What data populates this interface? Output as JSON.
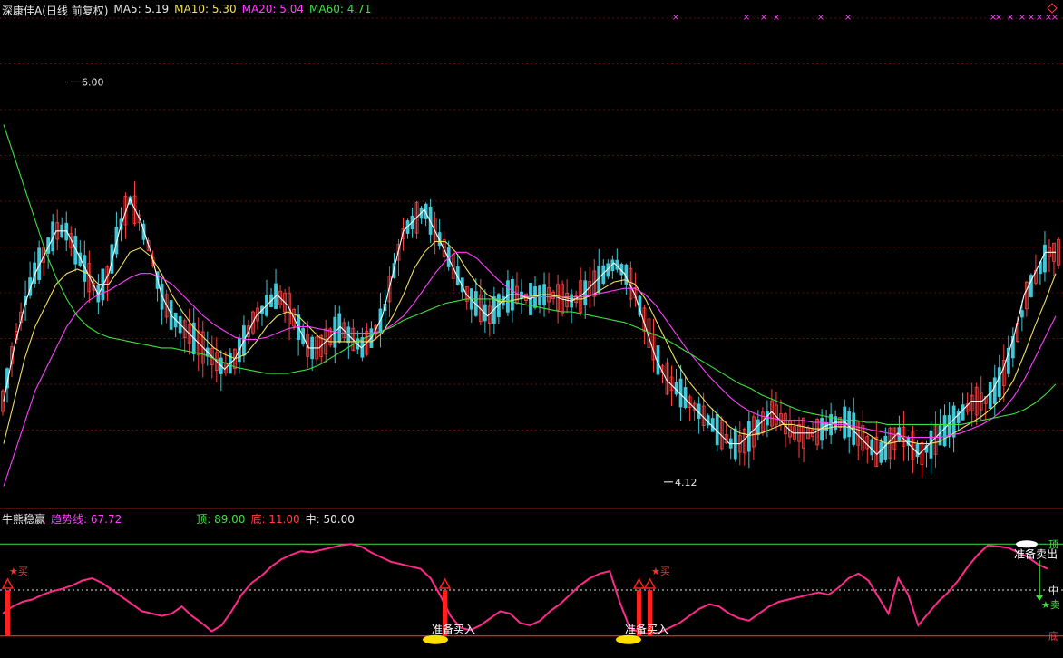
{
  "price_header": {
    "title": "深康佳A(日线 前复权)",
    "ma5": "MA5: 5.19",
    "ma10": "MA10: 5.30",
    "ma20": "MA20: 5.04",
    "ma60": "MA60: 4.71"
  },
  "indicator_header": {
    "title": "牛熊稳赢",
    "trend": "趋势线: 67.72",
    "top": "顶: 89.00",
    "bottom": "底: 11.00",
    "mid": "中: 50.00"
  },
  "colors": {
    "up": "#ff4040",
    "down": "#40c8d8",
    "ma5": "#ffffff",
    "ma10": "#f0e060",
    "ma20": "#ff40ff",
    "ma60": "#40e040",
    "trend": "#ff2a8a"
  },
  "chart_data": [
    {
      "type": "candlestick",
      "ylim": [
        4.0,
        6.3
      ],
      "grid": true,
      "annotations": [
        {
          "label": "6.00",
          "x": 78,
          "value": 6.0
        },
        {
          "label": "4.12",
          "x": 732,
          "value": 4.12
        }
      ],
      "series": [
        {
          "name": "MA5",
          "values": [
            4.5,
            4.75,
            4.95,
            5.1,
            5.2,
            5.3,
            5.3,
            5.2,
            5.1,
            5.0,
            5.1,
            5.3,
            5.45,
            5.35,
            5.2,
            5.0,
            4.9,
            4.85,
            4.8,
            4.75,
            4.7,
            4.65,
            4.7,
            4.8,
            4.9,
            4.95,
            5.0,
            4.95,
            4.85,
            4.75,
            4.75,
            4.8,
            4.85,
            4.8,
            4.75,
            4.8,
            4.9,
            5.1,
            5.3,
            5.35,
            5.4,
            5.3,
            5.2,
            5.1,
            5.0,
            4.95,
            4.9,
            4.95,
            5.0,
            5.0,
            4.98,
            5.0,
            5.0,
            4.98,
            4.97,
            5.0,
            5.05,
            5.1,
            5.15,
            5.1,
            5.0,
            4.85,
            4.7,
            4.6,
            4.55,
            4.5,
            4.45,
            4.4,
            4.35,
            4.3,
            4.3,
            4.35,
            4.4,
            4.45,
            4.4,
            4.35,
            4.35,
            4.35,
            4.38,
            4.4,
            4.4,
            4.35,
            4.3,
            4.25,
            4.3,
            4.35,
            4.3,
            4.25,
            4.3,
            4.35,
            4.4,
            4.45,
            4.5,
            4.5,
            4.55,
            4.65,
            4.8,
            5.0,
            5.1,
            5.2,
            5.2
          ]
        },
        {
          "name": "MA10",
          "values": [
            4.3,
            4.5,
            4.7,
            4.85,
            4.95,
            5.05,
            5.1,
            5.12,
            5.1,
            5.05,
            5.05,
            5.12,
            5.2,
            5.22,
            5.18,
            5.1,
            5.0,
            4.92,
            4.85,
            4.8,
            4.75,
            4.72,
            4.7,
            4.72,
            4.78,
            4.85,
            4.9,
            4.92,
            4.9,
            4.85,
            4.8,
            4.78,
            4.78,
            4.78,
            4.78,
            4.78,
            4.82,
            4.9,
            5.0,
            5.12,
            5.2,
            5.25,
            5.25,
            5.2,
            5.12,
            5.05,
            5.0,
            4.97,
            4.97,
            4.98,
            4.99,
            5.0,
            5.0,
            4.99,
            4.98,
            4.98,
            5.0,
            5.03,
            5.06,
            5.07,
            5.05,
            4.98,
            4.88,
            4.78,
            4.68,
            4.6,
            4.54,
            4.48,
            4.43,
            4.38,
            4.35,
            4.34,
            4.35,
            4.37,
            4.39,
            4.39,
            4.38,
            4.37,
            4.37,
            4.38,
            4.38,
            4.37,
            4.35,
            4.32,
            4.3,
            4.31,
            4.31,
            4.3,
            4.3,
            4.31,
            4.34,
            4.37,
            4.4,
            4.43,
            4.47,
            4.52,
            4.6,
            4.72,
            4.85,
            4.97,
            5.1
          ]
        },
        {
          "name": "MA20",
          "values": [
            4.1,
            4.25,
            4.4,
            4.55,
            4.65,
            4.75,
            4.85,
            4.92,
            4.97,
            5.0,
            5.02,
            5.05,
            5.08,
            5.1,
            5.1,
            5.08,
            5.05,
            5.0,
            4.95,
            4.9,
            4.86,
            4.83,
            4.8,
            4.79,
            4.79,
            4.8,
            4.82,
            4.84,
            4.85,
            4.85,
            4.84,
            4.83,
            4.82,
            4.82,
            4.82,
            4.82,
            4.83,
            4.86,
            4.9,
            4.96,
            5.03,
            5.1,
            5.16,
            5.2,
            5.2,
            5.17,
            5.12,
            5.07,
            5.03,
            5.0,
            4.99,
            4.99,
            4.99,
            4.99,
            4.99,
            4.99,
            5.0,
            5.01,
            5.02,
            5.03,
            5.03,
            5.0,
            4.95,
            4.88,
            4.81,
            4.74,
            4.68,
            4.62,
            4.57,
            4.52,
            4.48,
            4.45,
            4.43,
            4.42,
            4.41,
            4.41,
            4.41,
            4.4,
            4.4,
            4.39,
            4.39,
            4.38,
            4.37,
            4.36,
            4.35,
            4.34,
            4.33,
            4.33,
            4.33,
            4.33,
            4.34,
            4.35,
            4.37,
            4.39,
            4.42,
            4.46,
            4.52,
            4.6,
            4.7,
            4.8,
            4.9
          ]
        },
        {
          "name": "MA60",
          "values": [
            5.8,
            5.65,
            5.5,
            5.35,
            5.2,
            5.08,
            4.98,
            4.9,
            4.85,
            4.82,
            4.8,
            4.79,
            4.78,
            4.77,
            4.76,
            4.75,
            4.75,
            4.74,
            4.73,
            4.72,
            4.7,
            4.68,
            4.66,
            4.65,
            4.64,
            4.63,
            4.63,
            4.63,
            4.64,
            4.65,
            4.67,
            4.7,
            4.73,
            4.76,
            4.79,
            4.81,
            4.83,
            4.85,
            4.88,
            4.9,
            4.92,
            4.94,
            4.96,
            4.97,
            4.98,
            4.98,
            4.98,
            4.98,
            4.97,
            4.96,
            4.95,
            4.94,
            4.93,
            4.92,
            4.92,
            4.91,
            4.9,
            4.89,
            4.88,
            4.87,
            4.85,
            4.83,
            4.81,
            4.79,
            4.76,
            4.73,
            4.7,
            4.67,
            4.64,
            4.61,
            4.58,
            4.56,
            4.53,
            4.51,
            4.49,
            4.47,
            4.45,
            4.44,
            4.43,
            4.42,
            4.41,
            4.41,
            4.4,
            4.4,
            4.39,
            4.39,
            4.39,
            4.39,
            4.39,
            4.39,
            4.39,
            4.39,
            4.4,
            4.41,
            4.42,
            4.43,
            4.44,
            4.46,
            4.49,
            4.53,
            4.58
          ]
        }
      ]
    },
    {
      "type": "line",
      "ylim": [
        0,
        100
      ],
      "reference_lines": [
        {
          "name": "顶",
          "value": 89
        },
        {
          "name": "中",
          "value": 50
        },
        {
          "name": "底",
          "value": 11
        }
      ],
      "side_labels": {
        "top": "顶",
        "mid": "中",
        "bottom": "底"
      },
      "series": [
        {
          "name": "趋势线",
          "values": [
            30,
            36,
            40,
            42,
            46,
            49,
            51,
            54,
            58,
            60,
            56,
            50,
            44,
            38,
            32,
            30,
            28,
            30,
            36,
            28,
            22,
            15,
            20,
            32,
            46,
            56,
            62,
            70,
            76,
            80,
            83,
            82,
            84,
            86,
            88,
            89,
            87,
            82,
            78,
            74,
            72,
            70,
            68,
            60,
            45,
            28,
            18,
            16,
            20,
            26,
            32,
            30,
            22,
            20,
            24,
            32,
            38,
            46,
            54,
            60,
            64,
            66,
            40,
            18,
            14,
            13,
            14,
            18,
            22,
            28,
            34,
            38,
            36,
            30,
            26,
            24,
            30,
            36,
            40,
            42,
            44,
            46,
            48,
            46,
            52,
            60,
            64,
            58,
            44,
            30,
            60,
            46,
            20,
            30,
            40,
            48,
            58,
            70,
            80,
            88,
            87,
            86,
            82,
            78,
            72,
            68
          ]
        },
        {
          "name": "MA",
          "values": []
        }
      ],
      "annotations": [
        {
          "label": "买",
          "x": 10
        },
        {
          "label": "准备买入",
          "x": 495
        },
        {
          "label": "买",
          "x": 725
        },
        {
          "label": "准备买入",
          "x": 705
        },
        {
          "label": "准备卖出",
          "x": 1140
        },
        {
          "label": "卖",
          "x": 1158
        }
      ]
    }
  ],
  "labels": {
    "buy": "买",
    "sell": "卖",
    "prep_buy": "准备买入",
    "prep_sell": "准备卖出",
    "top": "顶",
    "mid": "中",
    "bottom": "底",
    "high": "6.00",
    "low": "4.12"
  }
}
